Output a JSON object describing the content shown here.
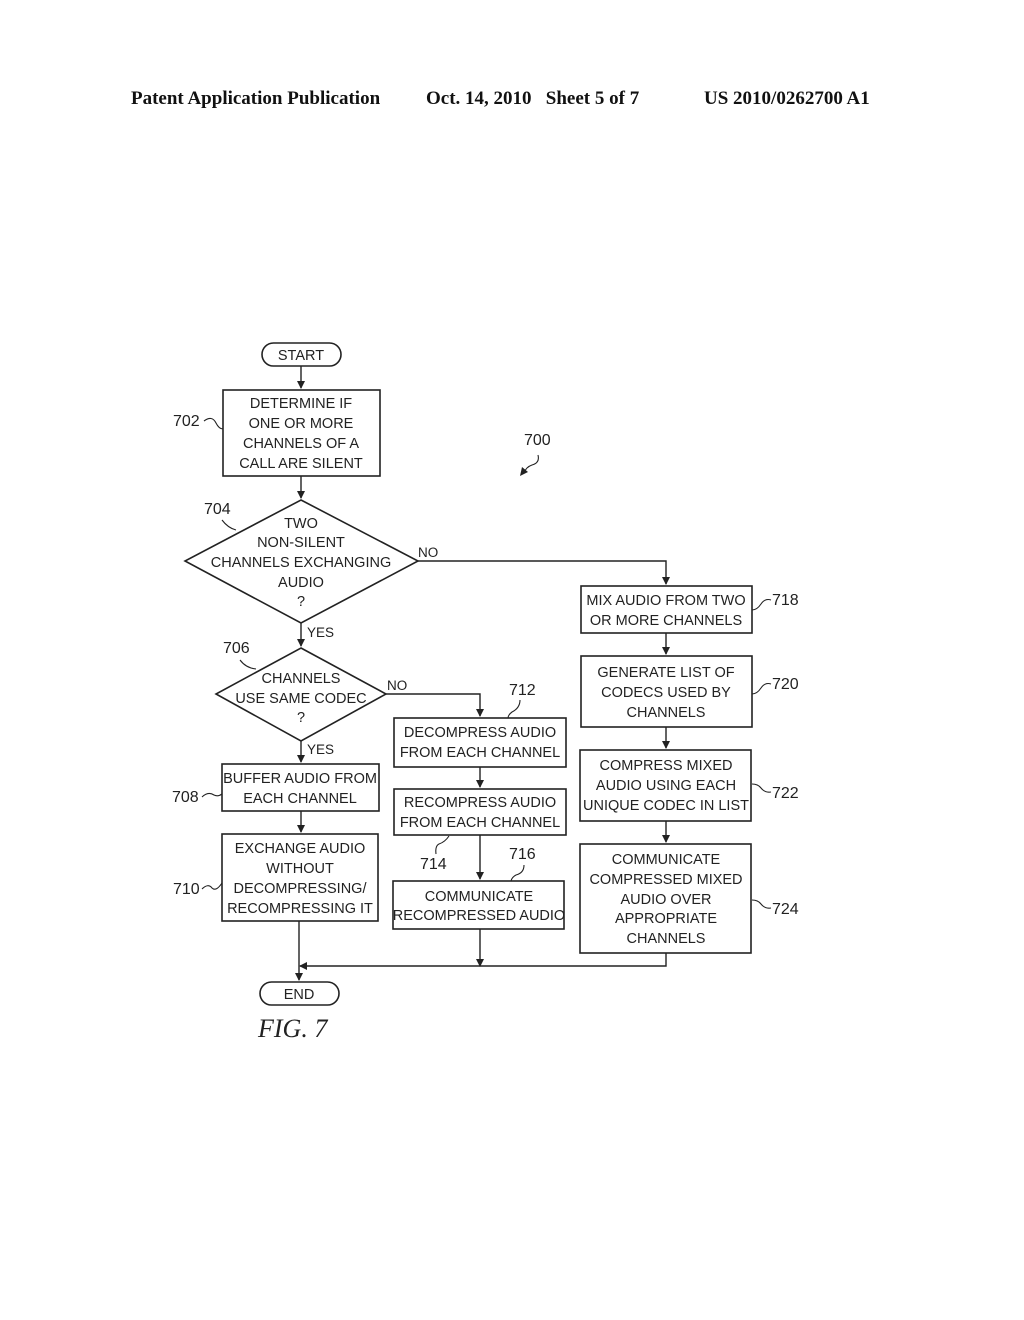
{
  "header": {
    "publication": "Patent Application Publication",
    "date_sheet": "Oct. 14, 2010   Sheet 5 of 7",
    "patent_number": "US 2010/0262700 A1"
  },
  "figure": {
    "caption": "FIG. 7",
    "ref": "700",
    "start": "START",
    "end": "END",
    "yes": "YES",
    "no": "NO",
    "steps": {
      "s702": {
        "ref": "702",
        "lines": [
          "DETERMINE IF",
          "ONE OR MORE",
          "CHANNELS OF A",
          "CALL ARE SILENT"
        ]
      },
      "s704": {
        "ref": "704",
        "lines": [
          "TWO",
          "NON-SILENT",
          "CHANNELS EXCHANGING",
          "AUDIO",
          "?"
        ]
      },
      "s706": {
        "ref": "706",
        "lines": [
          "CHANNELS",
          "USE SAME CODEC",
          "?"
        ]
      },
      "s708": {
        "ref": "708",
        "lines": [
          "BUFFER AUDIO FROM",
          "EACH CHANNEL"
        ]
      },
      "s710": {
        "ref": "710",
        "lines": [
          "EXCHANGE AUDIO",
          "WITHOUT",
          "DECOMPRESSING/",
          "RECOMPRESSING IT"
        ]
      },
      "s712": {
        "ref": "712",
        "lines": [
          "DECOMPRESS AUDIO",
          "FROM EACH CHANNEL"
        ]
      },
      "s714": {
        "ref": "714",
        "lines": [
          "RECOMPRESS AUDIO",
          "FROM EACH CHANNEL"
        ]
      },
      "s716": {
        "ref": "716",
        "lines": [
          "COMMUNICATE",
          "RECOMPRESSED AUDIO"
        ]
      },
      "s718": {
        "ref": "718",
        "lines": [
          "MIX AUDIO FROM TWO",
          "OR MORE CHANNELS"
        ]
      },
      "s720": {
        "ref": "720",
        "lines": [
          "GENERATE LIST OF",
          "CODECS USED BY",
          "CHANNELS"
        ]
      },
      "s722": {
        "ref": "722",
        "lines": [
          "COMPRESS MIXED",
          "AUDIO USING EACH",
          "UNIQUE CODEC IN LIST"
        ]
      },
      "s724": {
        "ref": "724",
        "lines": [
          "COMMUNICATE",
          "COMPRESSED MIXED",
          "AUDIO OVER",
          "APPROPRIATE",
          "CHANNELS"
        ]
      }
    }
  }
}
